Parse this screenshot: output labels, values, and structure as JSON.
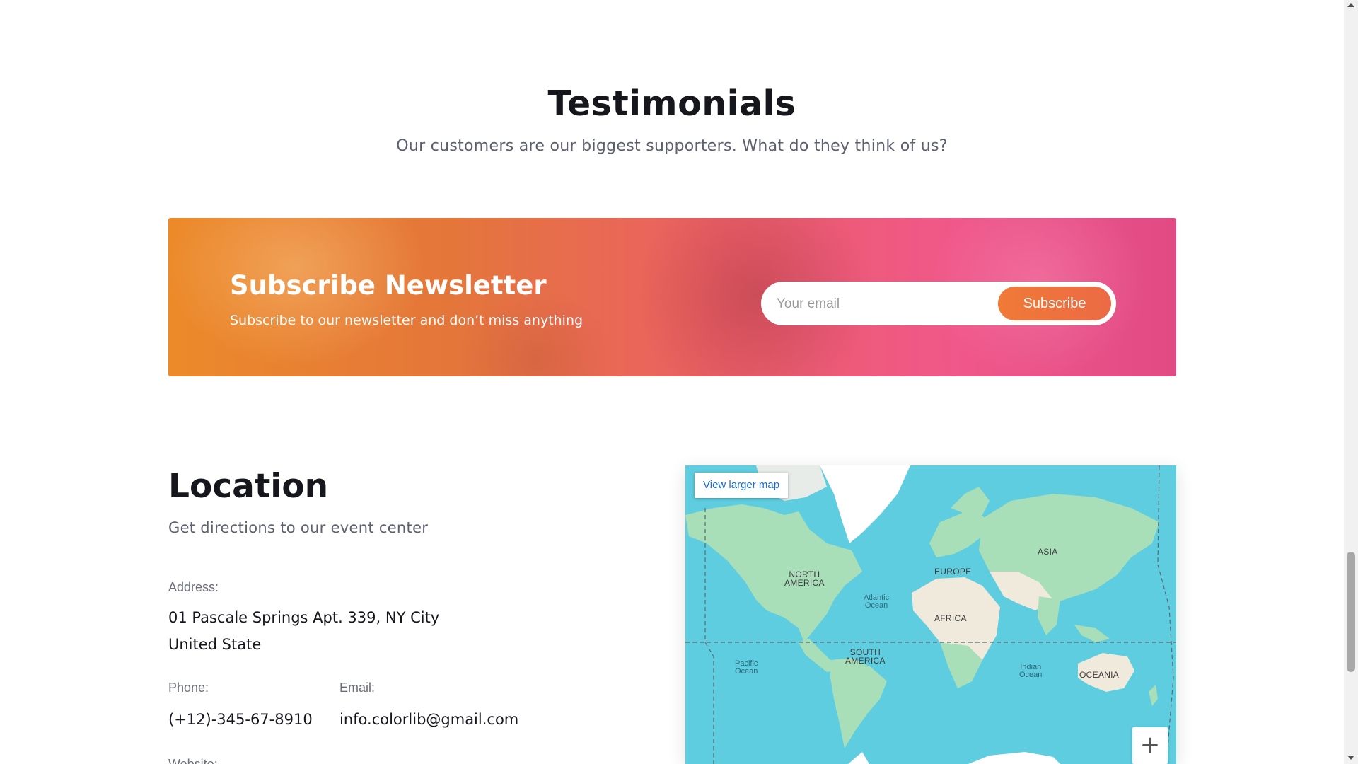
{
  "testimonials": {
    "title": "Testimonials",
    "subtitle": "Our customers are our biggest supporters. What do they think of us?"
  },
  "newsletter": {
    "title": "Subscribe Newsletter",
    "text": "Subscribe to our newsletter and don’t miss anything",
    "email_placeholder": "Your email",
    "button_label": "Subscribe",
    "colors": {
      "gradient_start": "#ec8a2a",
      "gradient_end": "#e14a84",
      "button": "#f07a36"
    }
  },
  "location": {
    "title": "Location",
    "subtitle": "Get directions to our event center",
    "address_label": "Address:",
    "address_line1": "01 Pascale Springs Apt. 339, NY City",
    "address_line2": "United State",
    "phone_label": "Phone:",
    "phone_value": "(+12)-345-67-8910",
    "email_label": "Email:",
    "email_value": "info.colorlib@gmail.com",
    "website_label": "Website:"
  },
  "map": {
    "view_larger_label": "View larger map",
    "zoom_in_label": "+",
    "continents": {
      "north_america": "NORTH\nAMERICA",
      "south_america": "SOUTH\nAMERICA",
      "europe": "EUROPE",
      "africa": "AFRICA",
      "asia": "ASIA",
      "oceania": "OCEANIA"
    },
    "oceans": {
      "atlantic": "Atlantic\nOcean",
      "pacific": "Pacific\nOcean",
      "indian": "Indian\nOcean"
    },
    "colors": {
      "water": "#5fcde0",
      "land": "#a8dfb8",
      "ice": "#ffffff"
    }
  }
}
